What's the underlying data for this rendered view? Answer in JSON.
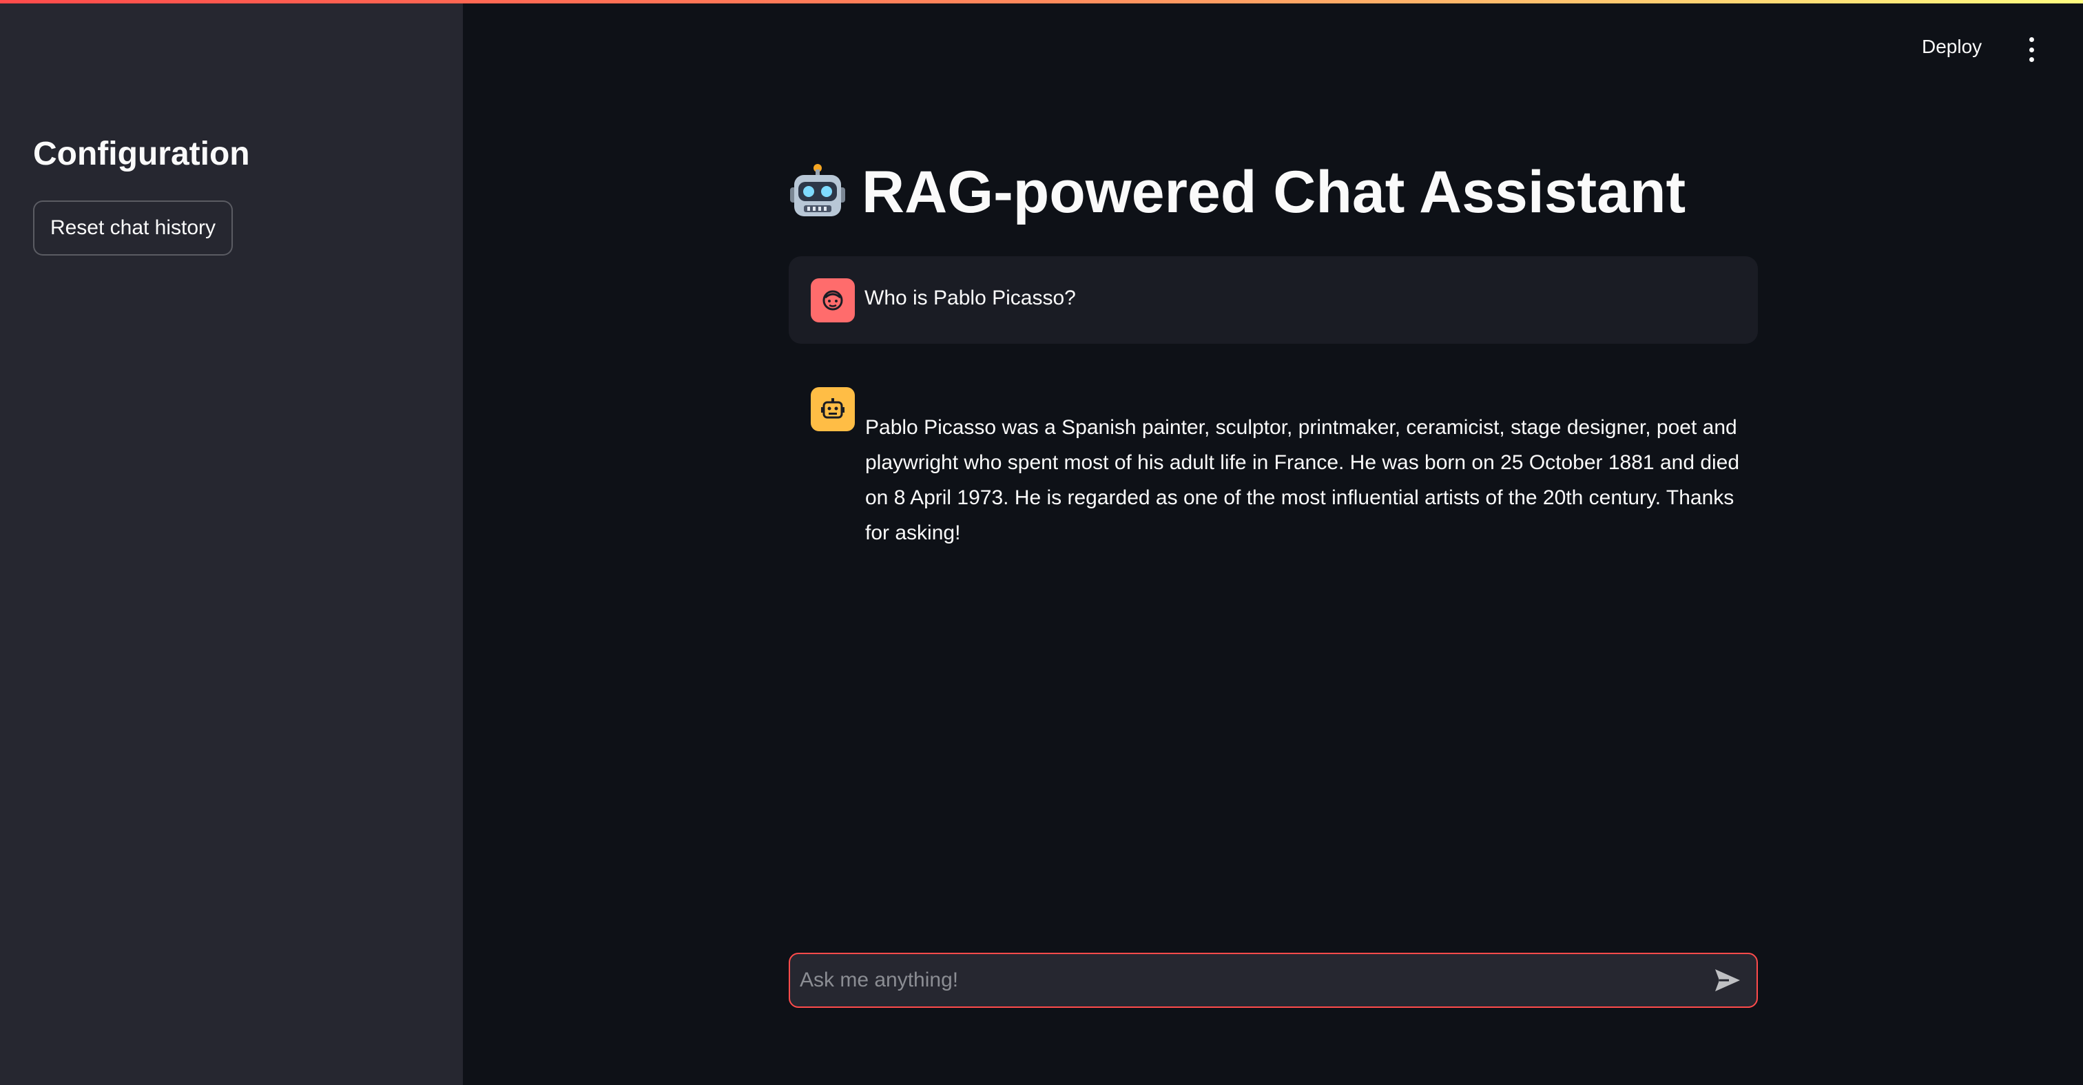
{
  "sidebar": {
    "title": "Configuration",
    "reset_button_label": "Reset chat history"
  },
  "header": {
    "deploy_label": "Deploy",
    "menu_icon": "vertical-dots-icon"
  },
  "main": {
    "title_icon": "robot-emoji",
    "title": "RAG-powered Chat Assistant"
  },
  "messages": [
    {
      "role": "user",
      "avatar_icon": "user-face-icon",
      "avatar_color": "#ff6c6c",
      "text": "Who is Pablo Picasso?"
    },
    {
      "role": "assistant",
      "avatar_icon": "robot-face-icon",
      "avatar_color": "#ffbd45",
      "text": "Pablo Picasso was a Spanish painter, sculptor, printmaker, ceramicist, stage designer, poet and playwright who spent most of his adult life in France. He was born on 25 October 1881 and died on 8 April 1973. He is regarded as one of the most influential artists of the 20th century. Thanks for asking!"
    }
  ],
  "chat_input": {
    "placeholder": "Ask me anything!",
    "value": "",
    "send_icon": "send-icon"
  },
  "colors": {
    "background": "#0e1117",
    "sidebar": "#262730",
    "accent": "#ff4b4b"
  }
}
